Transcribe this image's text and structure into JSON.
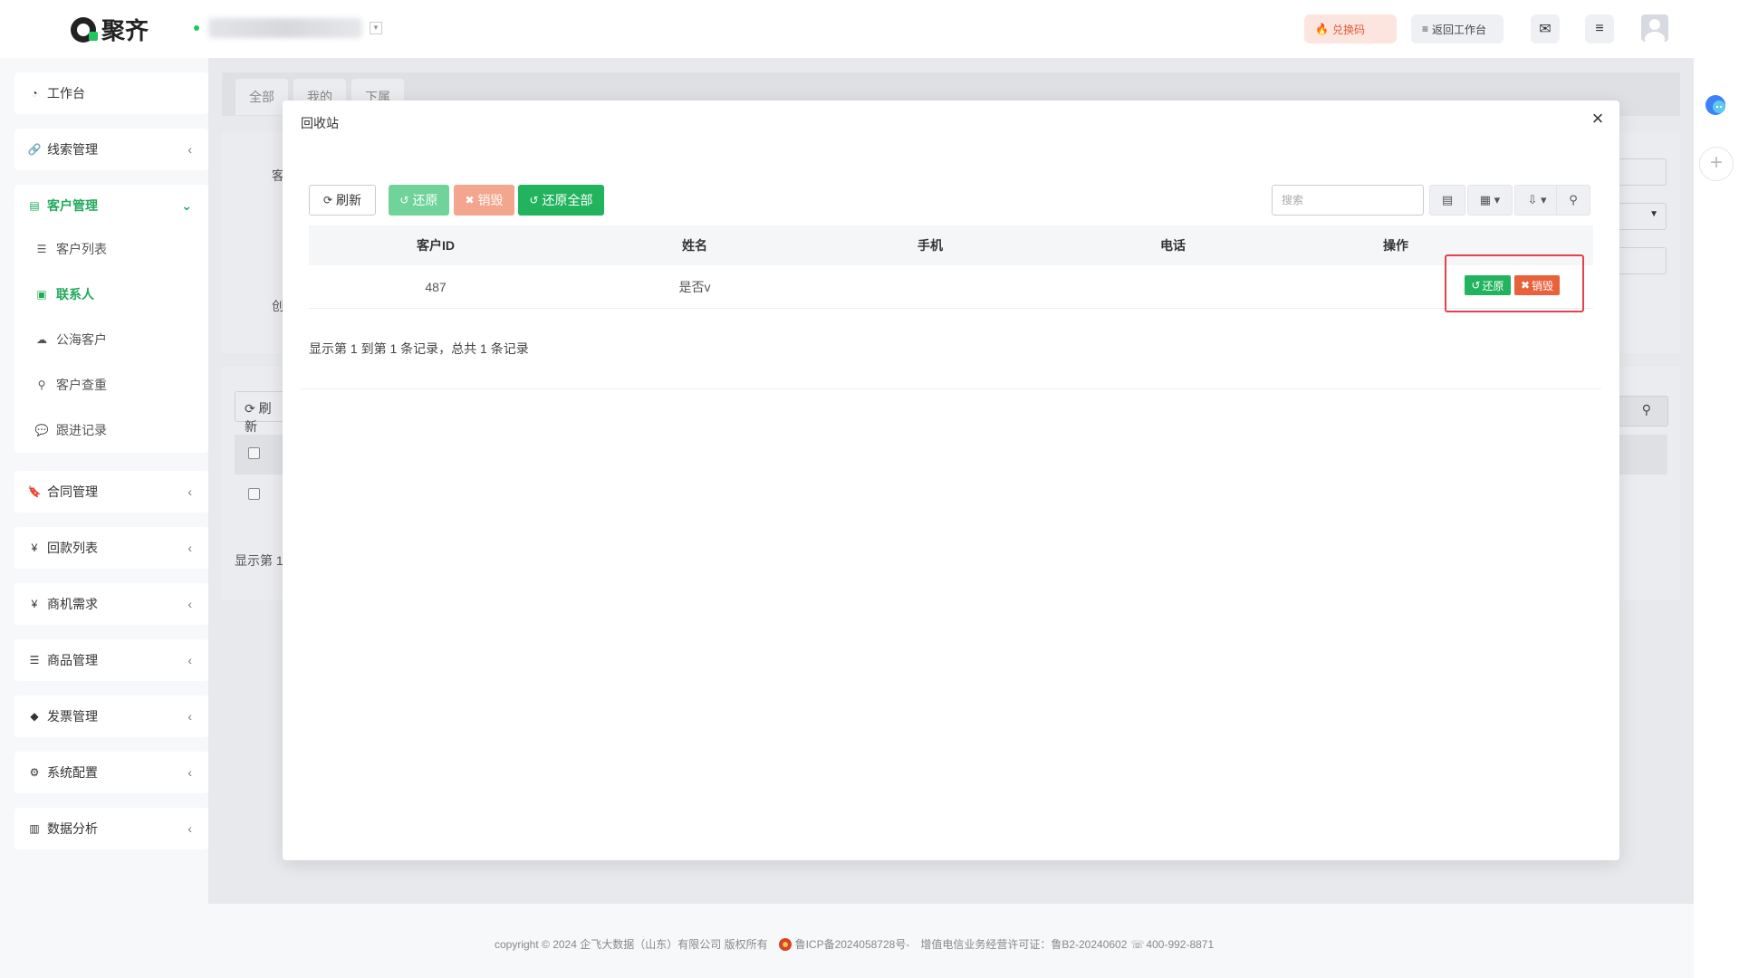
{
  "header": {
    "logo_text": "聚齐",
    "redeem_label": "兑换码",
    "back_label": "返回工作台"
  },
  "sidebar": {
    "items": [
      {
        "label": "工作台",
        "icon": "dashboard-icon"
      },
      {
        "label": "线索管理",
        "icon": "link-icon"
      },
      {
        "label": "客户管理",
        "icon": "id-card-icon"
      },
      {
        "label": "合同管理",
        "icon": "bookmark-icon"
      },
      {
        "label": "回款列表",
        "icon": "yen-icon"
      },
      {
        "label": "商机需求",
        "icon": "yen-icon"
      },
      {
        "label": "商品管理",
        "icon": "list-icon"
      },
      {
        "label": "发票管理",
        "icon": "tag-icon"
      },
      {
        "label": "系统配置",
        "icon": "gears-icon"
      },
      {
        "label": "数据分析",
        "icon": "bar-chart-icon"
      }
    ],
    "customer_sub": [
      {
        "label": "客户列表",
        "icon": "list-icon"
      },
      {
        "label": "联系人",
        "icon": "contact-icon"
      },
      {
        "label": "公海客户",
        "icon": "cloud-icon"
      },
      {
        "label": "客户查重",
        "icon": "search-icon"
      },
      {
        "label": "跟进记录",
        "icon": "comments-icon"
      }
    ]
  },
  "background": {
    "tabs": [
      "全部",
      "我的",
      "下属"
    ],
    "label_a": "客",
    "label_b": "创",
    "refresh_label": "刷新",
    "summary_prefix": "显示第 1"
  },
  "modal": {
    "title": "回收站",
    "toolbar": {
      "refresh": "刷新",
      "restore": "还原",
      "destroy": "销毁",
      "restore_all": "还原全部",
      "search_placeholder": "搜索"
    },
    "columns": [
      "客户ID",
      "姓名",
      "手机",
      "电话",
      "操作"
    ],
    "rows": [
      {
        "id": "487",
        "name": "是否v",
        "mobile": "",
        "phone": "",
        "actions": [
          "还原",
          "销毁"
        ]
      }
    ],
    "summary": "显示第 1 到第 1 条记录，总共 1 条记录"
  },
  "footer": {
    "copyright": "copyright © 2024 企飞大数据（山东）有限公司 版权所有",
    "icp": "鲁ICP备2024058728号-",
    "license": "增值电信业务经营许可证：鲁B2-20240602",
    "phone": "400-992-8871"
  },
  "colors": {
    "accent_green": "#22b35e",
    "destroy_orange": "#e8613b",
    "highlight_red": "#e5424d"
  }
}
